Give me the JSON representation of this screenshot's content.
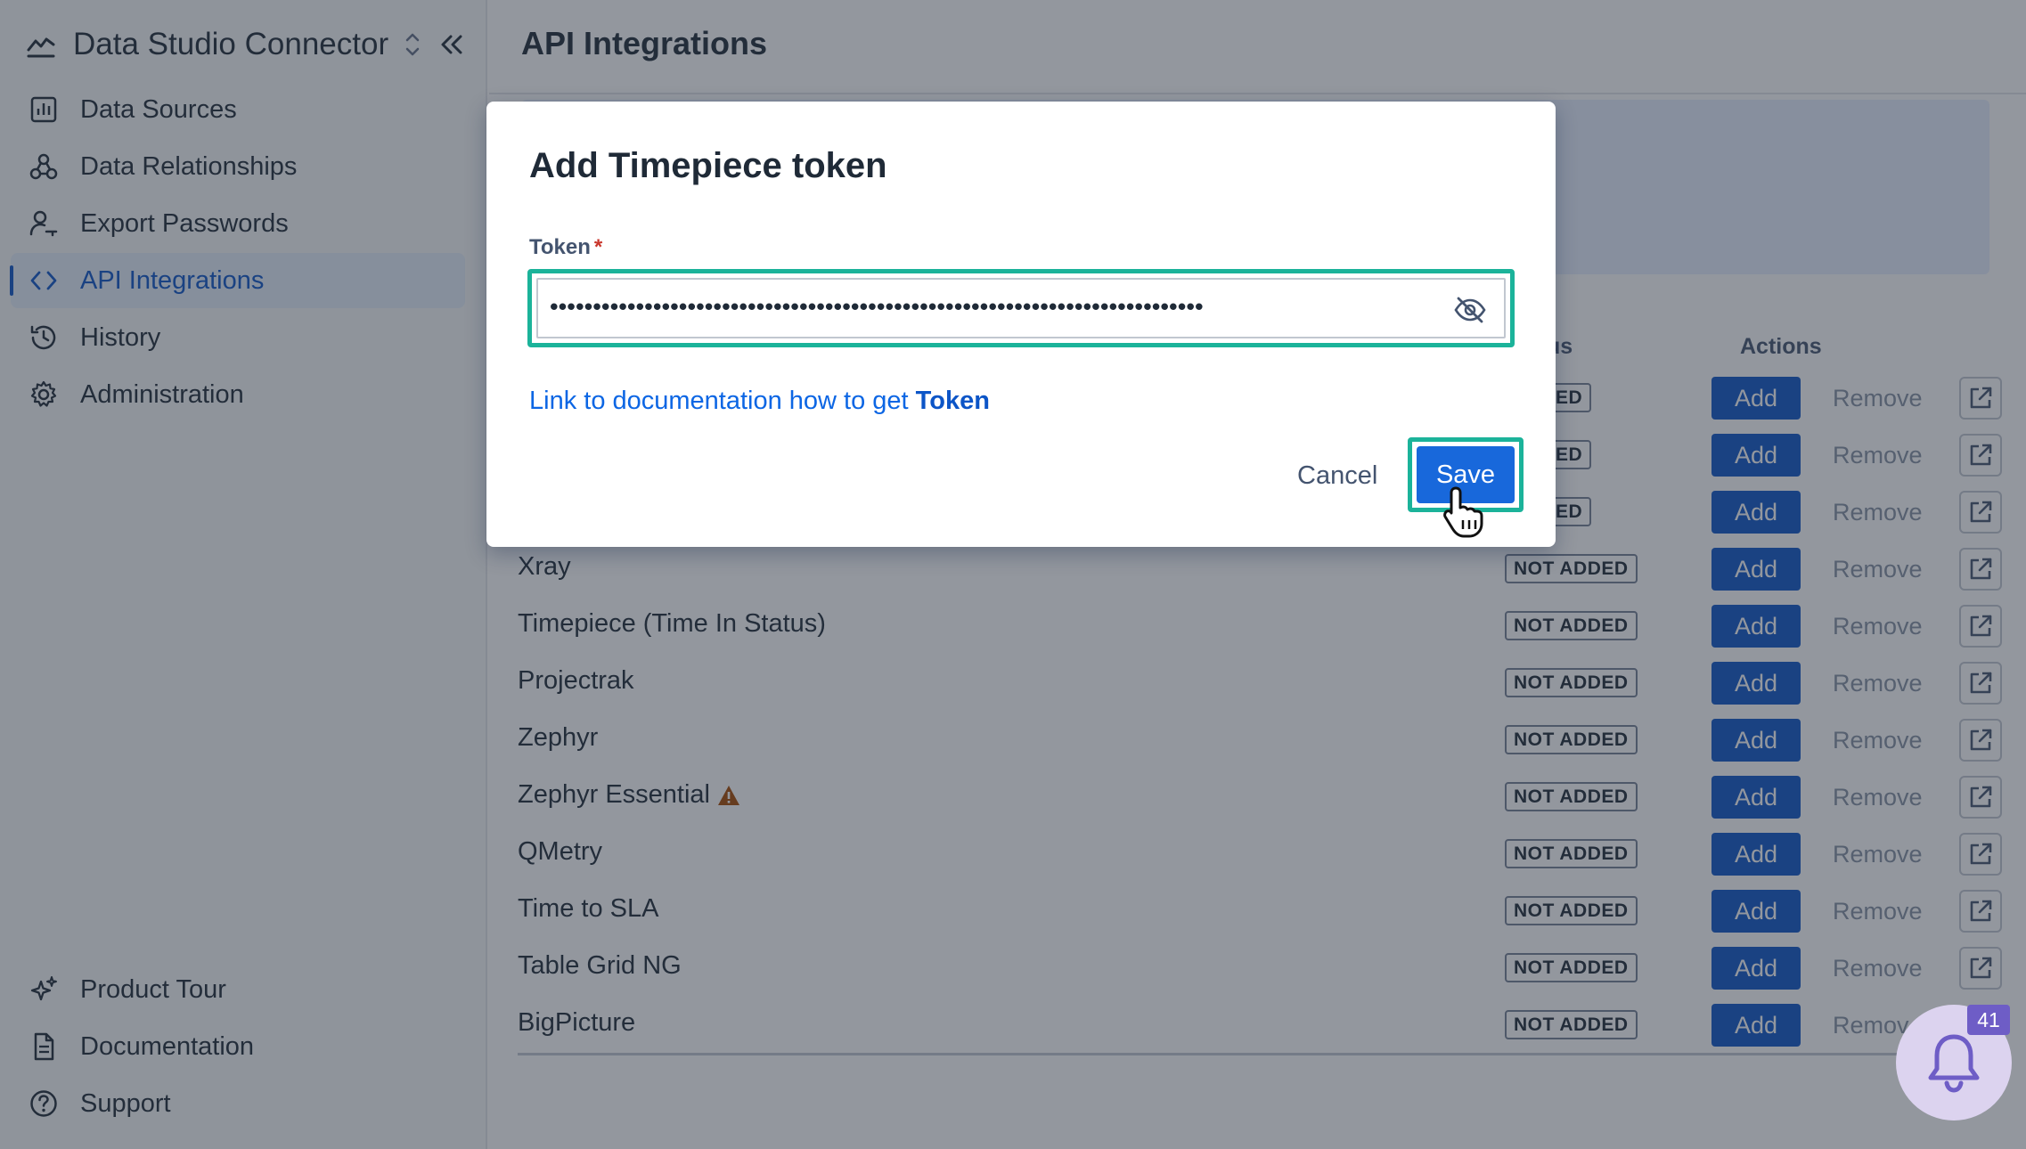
{
  "app": {
    "title": "Data Studio Connector"
  },
  "sidebar": {
    "items": [
      {
        "label": "Data Sources",
        "icon": "bar-chart-icon"
      },
      {
        "label": "Data Relationships",
        "icon": "relationship-icon"
      },
      {
        "label": "Export Passwords",
        "icon": "user-key-icon"
      },
      {
        "label": "API Integrations",
        "icon": "code-icon",
        "active": true
      },
      {
        "label": "History",
        "icon": "history-icon"
      },
      {
        "label": "Administration",
        "icon": "gear-icon"
      }
    ],
    "bottom_items": [
      {
        "label": "Product Tour",
        "icon": "sparkle-icon"
      },
      {
        "label": "Documentation",
        "icon": "document-icon"
      },
      {
        "label": "Support",
        "icon": "help-icon"
      }
    ]
  },
  "page": {
    "title": "API Integrations"
  },
  "table": {
    "status_header": "us",
    "actions_header": "Actions",
    "add_label": "Add",
    "remove_label": "Remove",
    "rows": [
      {
        "name": "",
        "status": "ADDED"
      },
      {
        "name": "",
        "status": "ADDED"
      },
      {
        "name": "",
        "status": "ADDED"
      },
      {
        "name": "Xray",
        "status": "NOT ADDED"
      },
      {
        "name": "Timepiece (Time In Status)",
        "status": "NOT ADDED"
      },
      {
        "name": "Projectrak",
        "status": "NOT ADDED"
      },
      {
        "name": "Zephyr",
        "status": "NOT ADDED"
      },
      {
        "name": "Zephyr Essential",
        "status": "NOT ADDED",
        "warning": true
      },
      {
        "name": "QMetry",
        "status": "NOT ADDED"
      },
      {
        "name": "Time to SLA",
        "status": "NOT ADDED"
      },
      {
        "name": "Table Grid NG",
        "status": "NOT ADDED"
      },
      {
        "name": "BigPicture",
        "status": "NOT ADDED"
      }
    ],
    "last_row_remove_label": "Remov"
  },
  "modal": {
    "title": "Add Timepiece token",
    "token_label": "Token",
    "required_mark": "*",
    "token_value": "••••••••••••••••••••••••••••••••••••••••••••••••••••••••••••••••••••••••••••",
    "doc_link_prefix": "Link to documentation how to get ",
    "doc_link_bold": "Token",
    "cancel_label": "Cancel",
    "save_label": "Save"
  },
  "notifications": {
    "count": "41"
  },
  "colors": {
    "accent": "#0c55c7",
    "focus_ring": "#1bb39a",
    "save": "#1868db"
  }
}
